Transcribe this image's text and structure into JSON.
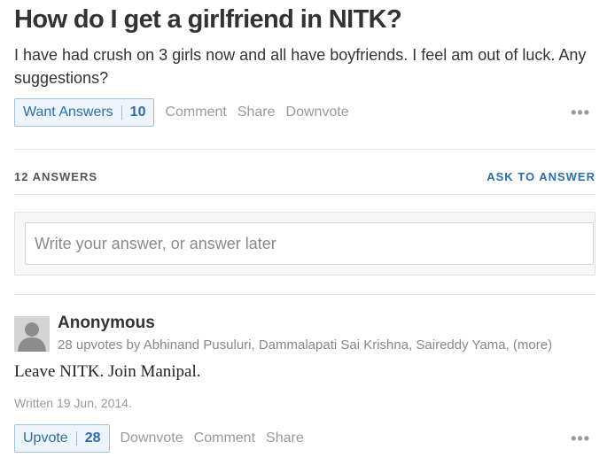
{
  "question": {
    "title": "How do I get a girlfriend in NITK?",
    "details": "I have had crush on 3 girls now and all have boyfriends. I feel am out of luck. Any suggestions?",
    "actions": {
      "want_answers_label": "Want Answers",
      "want_answers_count": "10",
      "comment": "Comment",
      "share": "Share",
      "downvote": "Downvote",
      "more": "•••"
    }
  },
  "answers_header": {
    "count_label": "12 ANSWERS",
    "ask_to_answer": "ASK TO ANSWER"
  },
  "answer_input": {
    "placeholder": "Write your answer, or answer later"
  },
  "answer": {
    "author": "Anonymous",
    "upvotes_text": "28 upvotes by Abhinand Pusuluri, Dammalapati Sai Krishna, Saireddy Yama,",
    "more_link": "(more)",
    "text": "Leave NITK. Join Manipal.",
    "written": "Written 19 Jun, 2014.",
    "actions": {
      "upvote_label": "Upvote",
      "upvote_count": "28",
      "downvote": "Downvote",
      "comment": "Comment",
      "share": "Share",
      "more": "•••"
    }
  },
  "icons": {
    "avatar": "default-user-silhouette-icon",
    "more": "more-horizontal-dots-icon"
  }
}
